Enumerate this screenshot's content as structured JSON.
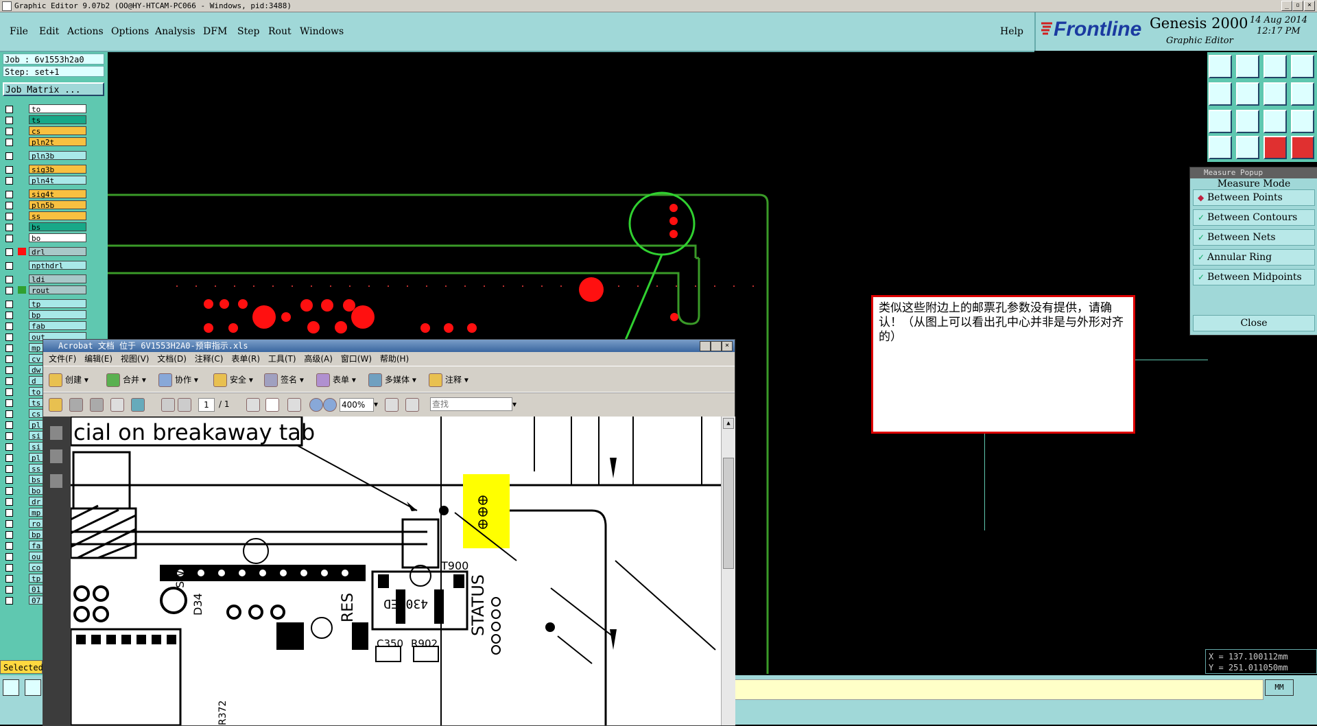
{
  "window": {
    "title": "Graphic Editor 9.07b2 (OO@HY-HTCAM-PC066 - Windows, pid:3488)"
  },
  "menu": {
    "items": [
      "File",
      "Edit",
      "Actions",
      "Options",
      "Analysis",
      "DFM",
      "Step",
      "Rout",
      "Windows"
    ],
    "help": "Help"
  },
  "brand": {
    "logo": "Frontline",
    "product": "Genesis 2000",
    "subtitle": "Graphic Editor",
    "date": "14 Aug 2014",
    "time": "12:17 PM"
  },
  "job": {
    "job_label": "Job : 6v1553h2a0",
    "step_label": "Step: set+1",
    "matrix_button": "Job Matrix ..."
  },
  "layers": [
    {
      "name": "to",
      "color": "#ffffff"
    },
    {
      "name": "ts",
      "color": "#18a888"
    },
    {
      "name": "cs",
      "color": "#f8c040"
    },
    {
      "name": "pln2t",
      "color": "#f8c040"
    },
    {
      "name": "pln3b",
      "color": "#a8e8e8"
    },
    {
      "name": "sig3b",
      "color": "#f8c040"
    },
    {
      "name": "pln4t",
      "color": "#a8e8e8"
    },
    {
      "name": "sig4t",
      "color": "#f8c040"
    },
    {
      "name": "pln5b",
      "color": "#f8c040"
    },
    {
      "name": "ss",
      "color": "#f8c040"
    },
    {
      "name": "bs",
      "color": "#18a888"
    },
    {
      "name": "bo",
      "color": "#ffffff"
    },
    {
      "name": "drl",
      "color": "#a8c8c8"
    },
    {
      "name": "npthdrl",
      "color": "#a8e8e8"
    },
    {
      "name": "ldi",
      "color": "#a8c8c8"
    },
    {
      "name": "rout",
      "color": "#a8c8c8"
    },
    {
      "name": "tp",
      "color": "#a8e8e8"
    },
    {
      "name": "bp",
      "color": "#a8e8e8"
    },
    {
      "name": "fab",
      "color": "#a8e8e8"
    },
    {
      "name": "out",
      "color": "#a8e8e8"
    },
    {
      "name": "mp",
      "color": "#a8e8e8"
    },
    {
      "name": "cv",
      "color": "#a8e8e8"
    },
    {
      "name": "dw",
      "color": "#a8e8e8"
    },
    {
      "name": "d",
      "color": "#a8e8e8"
    },
    {
      "name": "to",
      "color": "#a8e8e8"
    },
    {
      "name": "ts",
      "color": "#a8e8e8"
    },
    {
      "name": "cs",
      "color": "#a8e8e8"
    },
    {
      "name": "pl",
      "color": "#a8e8e8"
    },
    {
      "name": "si",
      "color": "#a8e8e8"
    },
    {
      "name": "si",
      "color": "#a8e8e8"
    },
    {
      "name": "pl",
      "color": "#a8e8e8"
    },
    {
      "name": "ss",
      "color": "#a8e8e8"
    },
    {
      "name": "bs",
      "color": "#a8e8e8"
    },
    {
      "name": "bo",
      "color": "#a8e8e8"
    },
    {
      "name": "dr",
      "color": "#a8e8e8"
    },
    {
      "name": "mp",
      "color": "#a8e8e8"
    },
    {
      "name": "ro",
      "color": "#a8e8e8"
    },
    {
      "name": "bp",
      "color": "#a8e8e8"
    },
    {
      "name": "fa",
      "color": "#a8e8e8"
    },
    {
      "name": "ou",
      "color": "#a8e8e8"
    },
    {
      "name": "co",
      "color": "#a8e8e8"
    },
    {
      "name": "tp",
      "color": "#a8e8e8"
    },
    {
      "name": "01",
      "color": "#a8e8e8"
    },
    {
      "name": "07",
      "color": "#a8e8e8"
    }
  ],
  "selected_label": "Selected",
  "measure_popup": {
    "title": "Measure Popup",
    "mode_label": "Measure Mode",
    "options": [
      "Between Points",
      "Between Contours",
      "Between Nets",
      "Annular Ring",
      "Between Midpoints"
    ],
    "close": "Close"
  },
  "coords": {
    "x": "X = 137.100112mm",
    "y": "Y = 251.011050mm"
  },
  "units": "MM",
  "annotation": "类似这些附边上的邮票孔参数没有提供，请确认！（从图上可以看出孔中心并非是与外形对齐的）",
  "acrobat": {
    "title": "Acrobat 文档 位于 6V1553H2A0-预审指示.xls",
    "menu": [
      "文件(F)",
      "编辑(E)",
      "视图(V)",
      "文档(D)",
      "注释(C)",
      "表单(R)",
      "工具(T)",
      "高级(A)",
      "窗口(W)",
      "帮助(H)"
    ],
    "toolbar1": [
      "创建",
      "合并",
      "协作",
      "安全",
      "签名",
      "表单",
      "多媒体",
      "注释"
    ],
    "page_current": "1",
    "page_total": "/ 1",
    "zoom": "400%",
    "search_placeholder": "查找",
    "doc_text": {
      "heading": "cial on breakaway tab",
      "label_sw": "SW",
      "label_d34": "D34",
      "label_res": "RES",
      "label_t900": "T900",
      "label_status": "STATUS",
      "label_4300": "4300ED",
      "label_c350": "C350",
      "label_r902": "R902",
      "label_r372": "R372"
    }
  }
}
